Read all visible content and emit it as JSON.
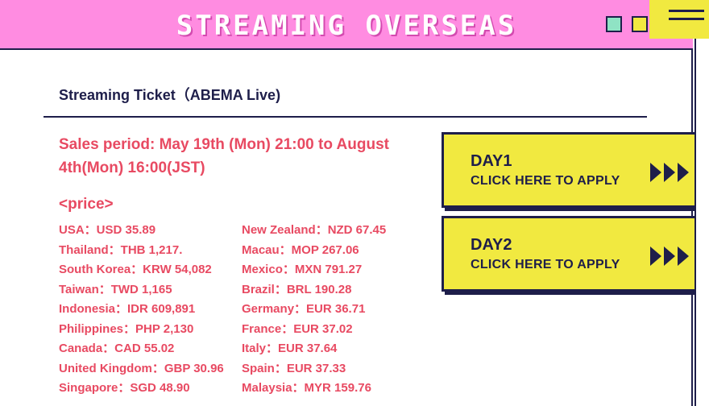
{
  "window": {
    "title": "STREAMING OVERSEAS",
    "colors": {
      "titlebar": "#ff8ce1",
      "accent_yellow": "#f1e940",
      "navy": "#1e1e4a",
      "price_red": "#e84a62",
      "button_green": "#8fe3c4"
    },
    "icons": [
      "minimize-green-icon",
      "maximize-yellow-icon",
      "hamburger-menu-icon"
    ]
  },
  "ticket": {
    "title": "Streaming Ticket（ABEMA Live)",
    "sales_period": "Sales period: May 19th (Mon) 21:00 to August 4th(Mon) 16:00(JST)",
    "price_heading": "<price>",
    "prices_left": [
      "USA：USD 35.89",
      "Thailand：THB 1,217.",
      "South Korea：KRW 54,082",
      "Taiwan：TWD 1,165",
      "Indonesia：IDR 609,891",
      "Philippines：PHP 2,130",
      "Canada：CAD 55.02",
      "United Kingdom：GBP 30.96",
      "Singapore：SGD 48.90"
    ],
    "prices_right": [
      "New Zealand：NZD 67.45",
      "Macau：MOP 267.06",
      "Mexico：MXN 791.27",
      "Brazil：BRL 190.28",
      "Germany：EUR 36.71",
      "France：EUR 37.02",
      "Italy：EUR 37.64",
      "Spain：EUR 37.33",
      "Malaysia：MYR 159.76"
    ]
  },
  "apply_buttons": [
    {
      "day": "DAY1",
      "label": "CLICK HERE TO APPLY",
      "icon": "triple-arrow-icon"
    },
    {
      "day": "DAY2",
      "label": "CLICK HERE TO APPLY",
      "icon": "triple-arrow-icon"
    }
  ]
}
